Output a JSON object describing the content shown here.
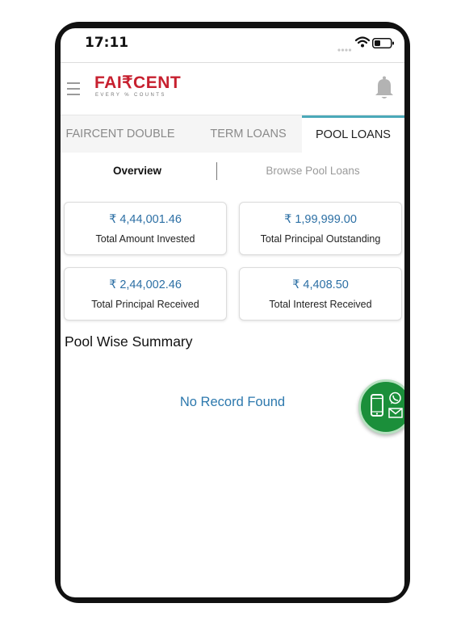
{
  "status_bar": {
    "time": "17:11",
    "signal_icon": "signal-dots-icon",
    "wifi_icon": "wifi-icon",
    "battery_icon": "battery-icon"
  },
  "header": {
    "menu_icon": "hamburger-menu-icon",
    "logo_text": "FAI₹CENT",
    "logo_tagline": "EVERY % COUNTS",
    "bell_icon": "bell-icon"
  },
  "tabs": [
    {
      "label": "FAIRCENT DOUBLE",
      "active": false
    },
    {
      "label": "TERM LOANS",
      "active": false
    },
    {
      "label": "POOL LOANS",
      "active": true
    }
  ],
  "subtabs": [
    {
      "label": "Overview",
      "active": true
    },
    {
      "label": "Browse Pool Loans",
      "active": false
    }
  ],
  "summary_cards": [
    {
      "value": "₹ 4,44,001.46",
      "label": "Total Amount Invested"
    },
    {
      "value": "₹ 1,99,999.00",
      "label": "Total Principal Outstanding"
    },
    {
      "value": "₹ 2,44,002.46",
      "label": "Total Principal Received"
    },
    {
      "value": "₹ 4,408.50",
      "label": "Total Interest Received"
    }
  ],
  "pool_summary": {
    "title": "Pool Wise Summary",
    "empty_message": "No Record Found"
  },
  "contact_button": {
    "icons": [
      "phone-icon",
      "whatsapp-icon",
      "mail-icon"
    ]
  },
  "colors": {
    "brand_red": "#c7202f",
    "value_blue": "#2c6fa4",
    "tab_accent": "#4aa9b9",
    "fab_green": "#1b8f3a"
  }
}
